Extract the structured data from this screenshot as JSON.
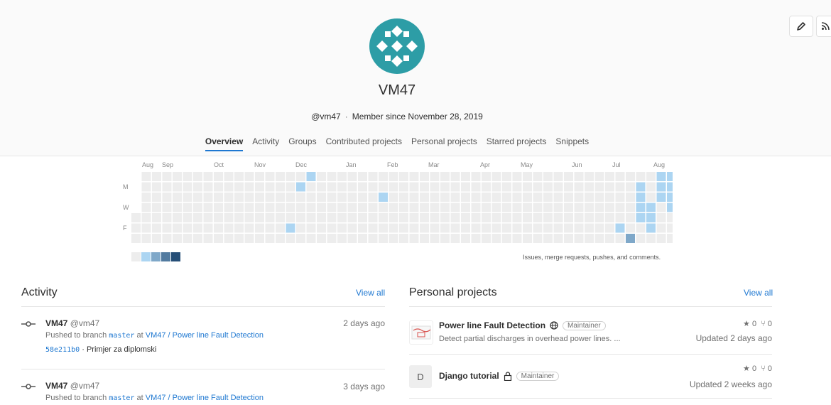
{
  "profile": {
    "name": "VM47",
    "handle": "@vm47",
    "separator": "·",
    "member_since": "Member since November 28, 2019"
  },
  "tabs": [
    {
      "label": "Overview",
      "active": true
    },
    {
      "label": "Activity"
    },
    {
      "label": "Groups"
    },
    {
      "label": "Contributed projects"
    },
    {
      "label": "Personal projects"
    },
    {
      "label": "Starred projects"
    },
    {
      "label": "Snippets"
    }
  ],
  "header_buttons": [
    {
      "icon": "pencil-icon"
    },
    {
      "icon": "rss-icon"
    }
  ],
  "calendar": {
    "months": [
      "Aug",
      "Sep",
      "Oct",
      "Nov",
      "Dec",
      "Jan",
      "Feb",
      "Mar",
      "Apr",
      "May",
      "Jun",
      "Jul",
      "Aug"
    ],
    "day_labels": [
      "M",
      "W",
      "F"
    ],
    "caption": "Issues, merge requests, pushes, and comments.",
    "colors": {
      "empty": "#ededed",
      "l1": "#acd5f2",
      "l2": "#7fa8c9",
      "l3": "#527ba0",
      "l4": "#254e77"
    },
    "contributions": [
      {
        "week": 17,
        "day": 0,
        "level": 1
      },
      {
        "week": 16,
        "day": 1,
        "level": 1
      },
      {
        "week": 24,
        "day": 2,
        "level": 1
      },
      {
        "week": 15,
        "day": 5,
        "level": 1
      },
      {
        "week": 47,
        "day": 5,
        "level": 1
      },
      {
        "week": 48,
        "day": 6,
        "level": 2
      },
      {
        "week": 49,
        "day": 1,
        "level": 1
      },
      {
        "week": 49,
        "day": 2,
        "level": 1
      },
      {
        "week": 49,
        "day": 3,
        "level": 1
      },
      {
        "week": 49,
        "day": 4,
        "level": 1
      },
      {
        "week": 50,
        "day": 3,
        "level": 1
      },
      {
        "week": 50,
        "day": 4,
        "level": 1
      },
      {
        "week": 50,
        "day": 5,
        "level": 1
      },
      {
        "week": 51,
        "day": 0,
        "level": 1
      },
      {
        "week": 51,
        "day": 1,
        "level": 1
      },
      {
        "week": 51,
        "day": 2,
        "level": 1
      },
      {
        "week": 52,
        "day": 0,
        "level": 1
      },
      {
        "week": 52,
        "day": 1,
        "level": 1
      },
      {
        "week": 52,
        "day": 2,
        "level": 1
      },
      {
        "week": 52,
        "day": 3,
        "level": 1
      }
    ]
  },
  "activity": {
    "title": "Activity",
    "view_all": "View all",
    "events": [
      {
        "author": "VM47",
        "handle": "@vm47",
        "time": "2 days ago",
        "action": "Pushed to branch",
        "branch": "master",
        "at": "at",
        "project": "VM47 / Power line Fault Detection",
        "commit_sha": "58e211b0",
        "commit_sep": "·",
        "commit_msg": "Primjer za diplomski"
      },
      {
        "author": "VM47",
        "handle": "@vm47",
        "time": "3 days ago",
        "action": "Pushed to branch",
        "branch": "master",
        "at": "at",
        "project": "VM47 / Power line Fault Detection"
      }
    ]
  },
  "projects": {
    "title": "Personal projects",
    "view_all": "View all",
    "items": [
      {
        "name": "Power line Fault Detection",
        "visibility_icon": "globe-icon",
        "role": "Maintainer",
        "description": "Detect partial discharges in overhead power lines. ...",
        "stars": "0",
        "forks": "0",
        "updated": "Updated 2 days ago"
      },
      {
        "avatar_letter": "D",
        "name": "Django tutorial",
        "visibility_icon": "lock-icon",
        "role": "Maintainer",
        "stars": "0",
        "forks": "0",
        "updated": "Updated 2 weeks ago"
      }
    ]
  }
}
